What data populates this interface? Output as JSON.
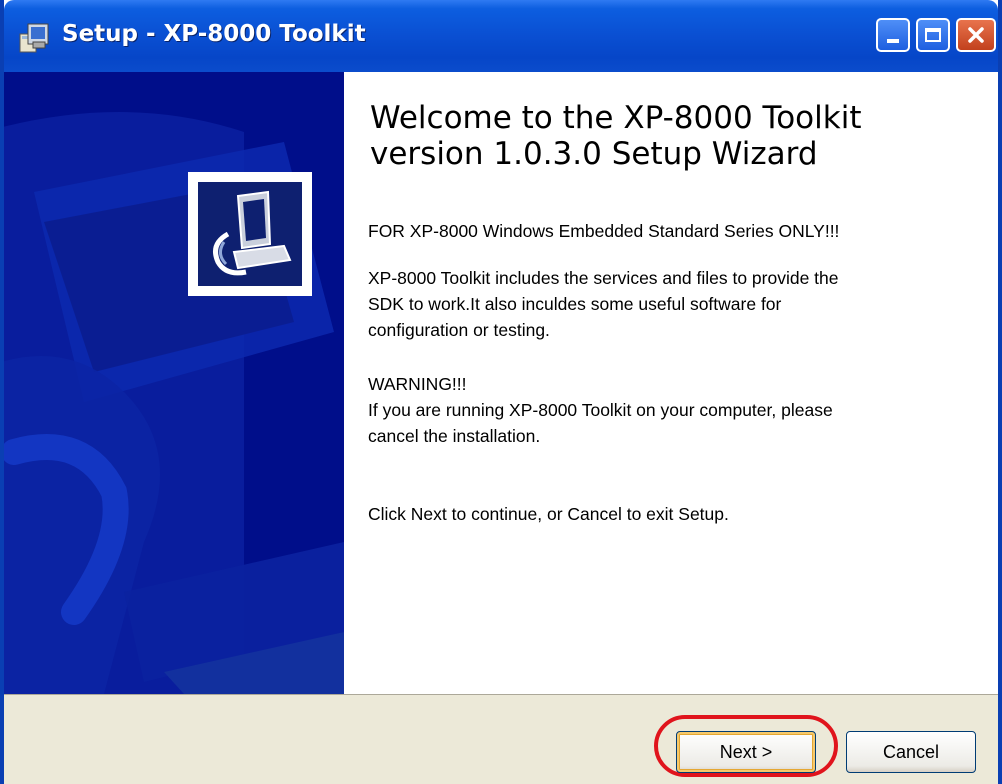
{
  "window": {
    "title": "Setup - XP-8000 Toolkit",
    "titlebar_color": "#0a4fd2",
    "side_panel_color": "#000e8a"
  },
  "icons": {
    "app": "setup-installer-icon",
    "minimize": "minimize-icon",
    "maximize": "maximize-icon",
    "close": "close-icon",
    "wizard_logo": "computer-install-icon"
  },
  "content": {
    "title": "Welcome to the XP-8000 Toolkit version 1.0.3.0 Setup Wizard",
    "paragraph_1": "FOR XP-8000 Windows Embedded Standard Series ONLY!!!",
    "paragraph_2": "XP-8000 Toolkit includes the services and files to provide the\nSDK to work.It also inculdes some useful software for\nconfiguration or testing.",
    "paragraph_3": "WARNING!!!\nIf you are running XP-8000 Toolkit on your computer, please\ncancel the installation.",
    "paragraph_4": "Click Next to continue, or Cancel to exit Setup."
  },
  "footer": {
    "next_label": "Next >",
    "cancel_label": "Cancel",
    "highlight_color": "#e0141c"
  }
}
